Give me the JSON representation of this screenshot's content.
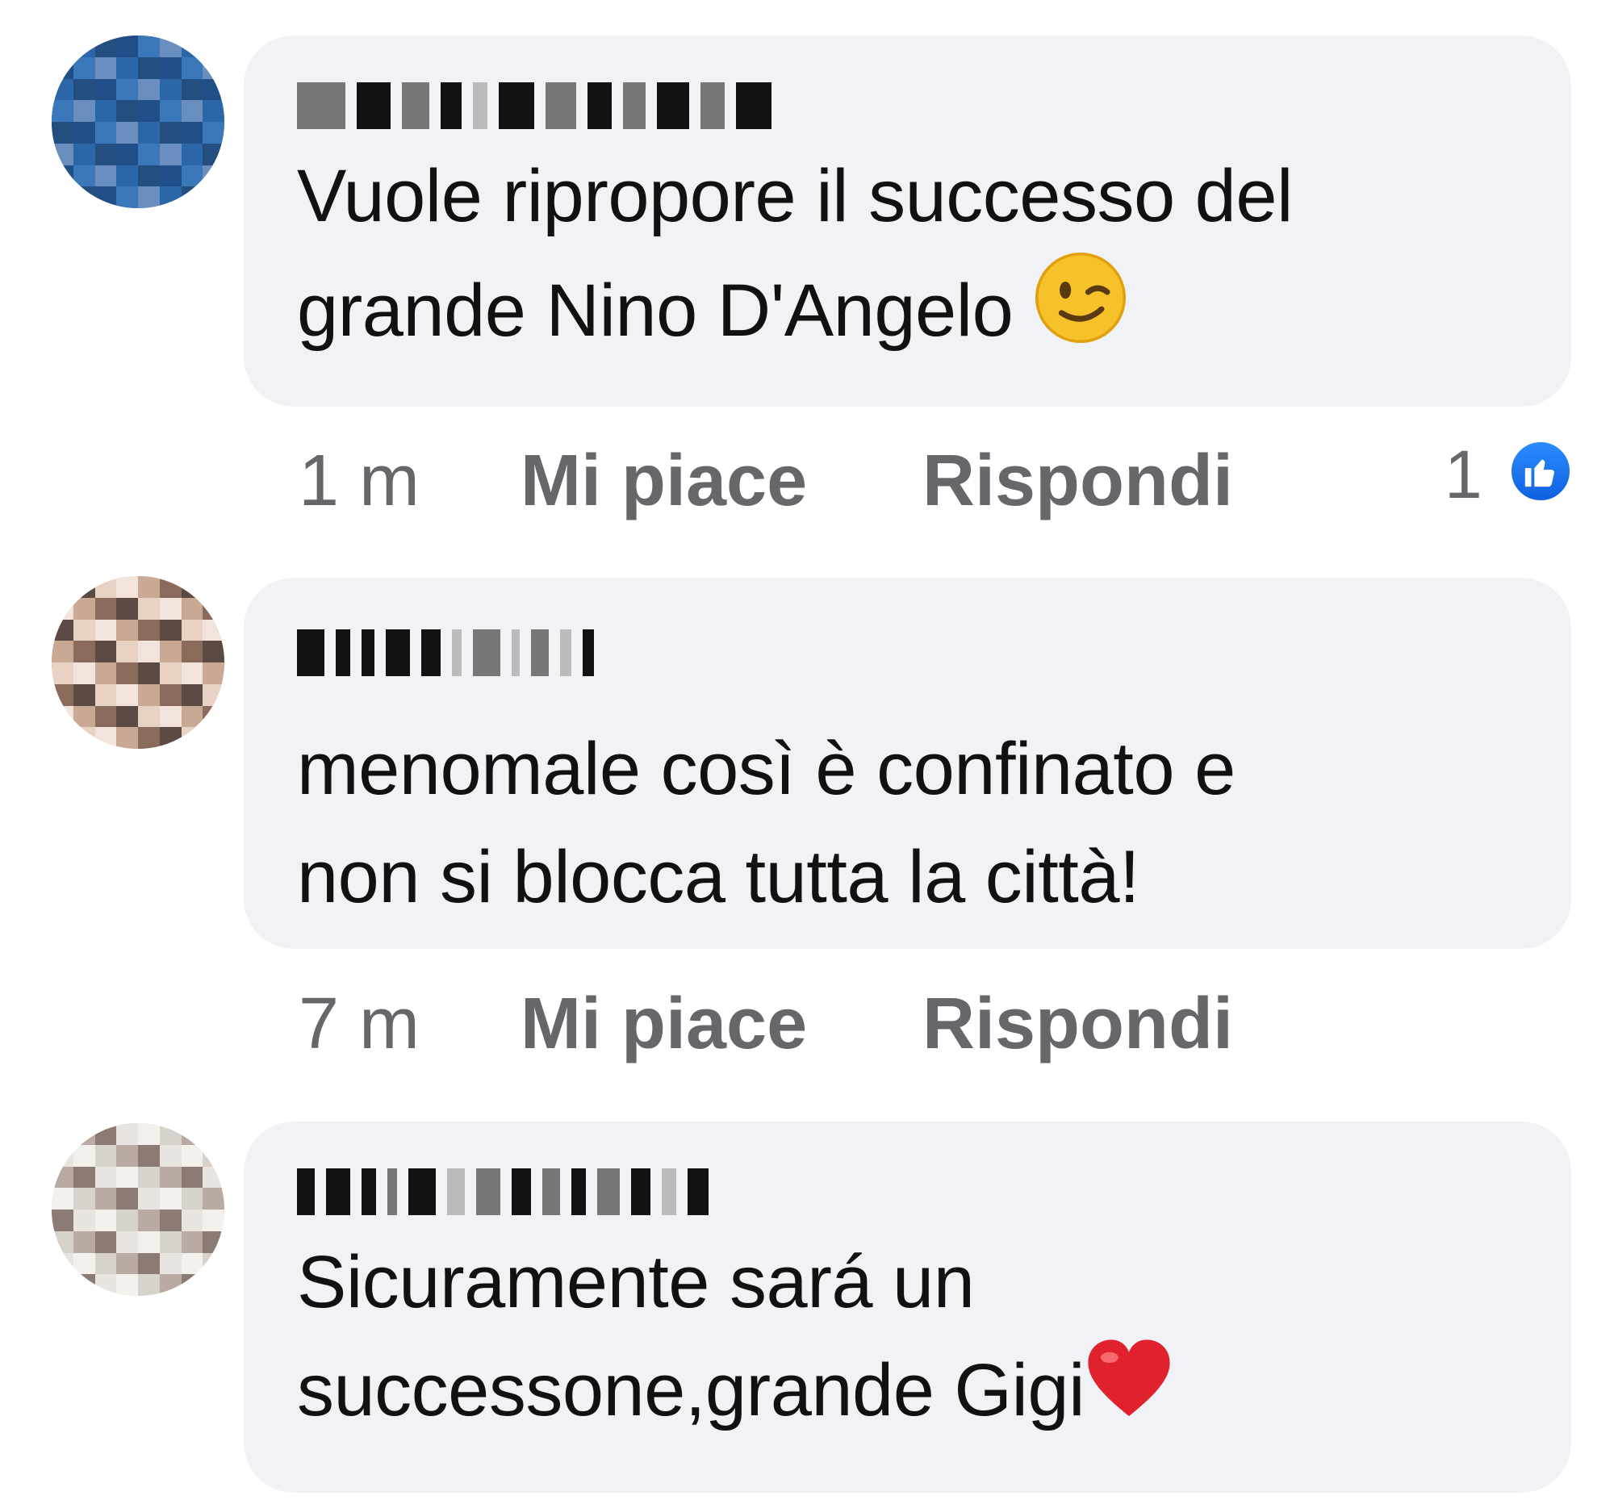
{
  "comments": [
    {
      "author_redacted": true,
      "text_line1": "Vuole ripropore il successo del",
      "text_line2": "grande Nino D'Angelo",
      "emoji": "winking-face",
      "time": "1 m",
      "like_label": "Mi piace",
      "reply_label": "Rispondi",
      "reaction_count": "1",
      "reaction_icon": "thumbs-up-icon"
    },
    {
      "author_redacted": true,
      "text_line1": "menomale così è confinato e",
      "text_line2": "non si blocca tutta la città!",
      "time": "7 m",
      "like_label": "Mi piace",
      "reply_label": "Rispondi"
    },
    {
      "author_redacted": true,
      "text_line1": "Sicuramente sará un",
      "text_line2": "successone,grande Gigi",
      "emoji": "red-heart"
    }
  ],
  "colors": {
    "bubble_bg": "#f0f2f5",
    "secondary_text": "#65676b",
    "like_blue": "#1877f2",
    "heart_red": "#e0212e"
  }
}
